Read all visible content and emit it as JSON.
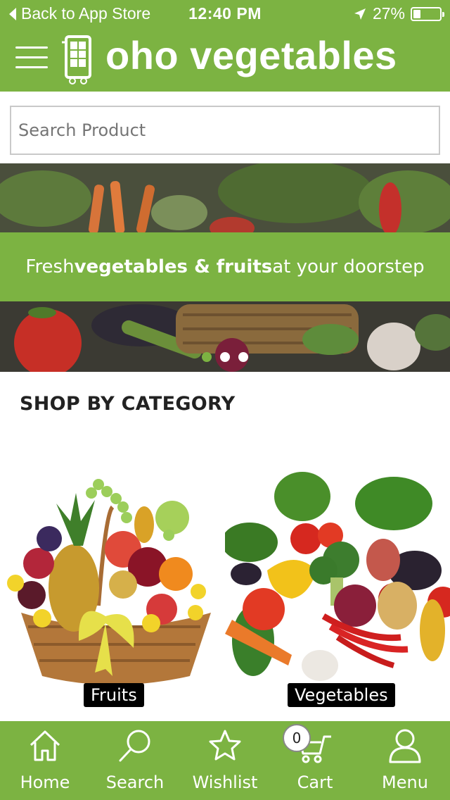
{
  "status_bar": {
    "back_label": "Back to App Store",
    "time": "12:40 PM",
    "battery": "27%",
    "battery_level": 0.27
  },
  "app": {
    "brand": "oho vegetables"
  },
  "search": {
    "placeholder": "Search Product"
  },
  "banner": {
    "text_1": "Fresh ",
    "text_2": "vegetables & fruits",
    "text_3": " at your doorstep",
    "slides": 3,
    "active_slide": 1
  },
  "categories": {
    "title": "SHOP BY CATEGORY",
    "items": [
      {
        "label": "Fruits"
      },
      {
        "label": "Vegetables"
      }
    ]
  },
  "tabbar": {
    "items": [
      {
        "label": "Home",
        "icon": "home-icon"
      },
      {
        "label": "Search",
        "icon": "search-icon"
      },
      {
        "label": "Wishlist",
        "icon": "star-icon"
      },
      {
        "label": "Cart",
        "icon": "cart-icon"
      },
      {
        "label": "Menu",
        "icon": "user-icon"
      }
    ],
    "cart_count": "0"
  },
  "colors": {
    "brand_green": "#7cb342",
    "white": "#ffffff",
    "label_bg": "#000000"
  }
}
